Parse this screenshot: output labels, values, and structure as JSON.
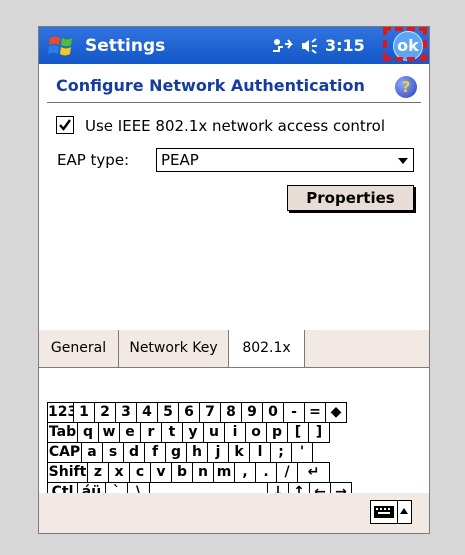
{
  "titlebar": {
    "app_title": "Settings",
    "clock": "3:15",
    "ok_label": "ok",
    "color": "#1e63d6"
  },
  "heading": "Configure Network Authentication",
  "help_label": "?",
  "checkbox": {
    "label": "Use IEEE 802.1x network access control",
    "checked": true
  },
  "eap": {
    "label": "EAP type:",
    "value": "PEAP"
  },
  "properties_button": "Properties",
  "tabs": [
    {
      "label": "General"
    },
    {
      "label": "Network Key"
    },
    {
      "label": "802.1x",
      "active": true
    }
  ],
  "keyboard": {
    "rows": [
      [
        "123",
        "1",
        "2",
        "3",
        "4",
        "5",
        "6",
        "7",
        "8",
        "9",
        "0",
        "-",
        "=",
        "◆"
      ],
      [
        "Tab",
        "q",
        "w",
        "e",
        "r",
        "t",
        "y",
        "u",
        "i",
        "o",
        "p",
        "[",
        "]"
      ],
      [
        "CAP",
        "a",
        "s",
        "d",
        "f",
        "g",
        "h",
        "j",
        "k",
        "l",
        ";",
        "'"
      ],
      [
        "Shift",
        "z",
        "x",
        "c",
        "v",
        "b",
        "n",
        "m",
        ",",
        ".",
        "/",
        "↵"
      ],
      [
        "Ctl",
        "áü",
        "`",
        "\\",
        "",
        "↓",
        "↑",
        "←",
        "→"
      ]
    ]
  },
  "icons": {
    "start": "windows-flag-icon",
    "network": "network-connection-icon",
    "volume": "speaker-icon",
    "help": "help-icon",
    "keyboard": "keyboard-icon"
  }
}
